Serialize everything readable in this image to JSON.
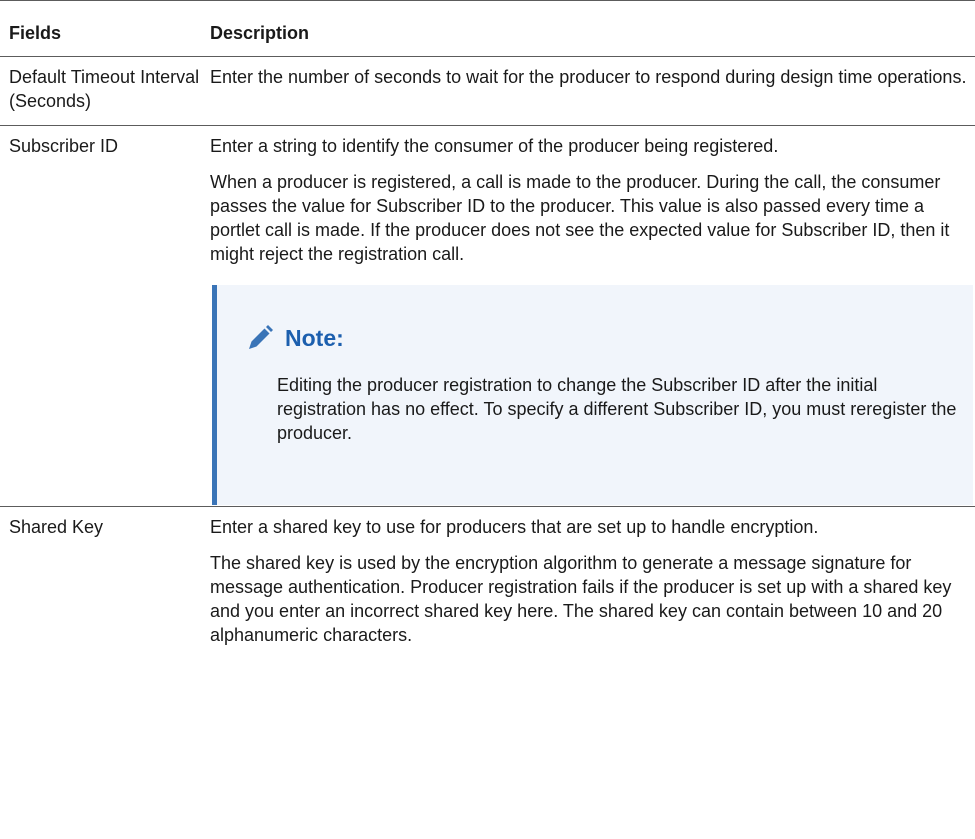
{
  "table": {
    "headers": [
      "Fields",
      "Description"
    ],
    "rows": [
      {
        "field": "Default Timeout Interval (Seconds)",
        "paragraphs": [
          "Enter the number of seconds to wait for the producer to respond during design time operations."
        ]
      },
      {
        "field": "Subscriber ID",
        "paragraphs": [
          "Enter a string to identify the consumer of the producer being registered.",
          "When a producer is registered, a call is made to the producer. During the call, the consumer passes the value for Subscriber ID to the producer. This value is also passed every time a portlet call is made. If the producer does not see the expected value for Subscriber ID, then it might reject the registration call."
        ],
        "note": {
          "icon": "pencil-icon",
          "title": "Note:",
          "text": "Editing the producer registration to change the Subscriber ID after the initial registration has no effect. To specify a different Subscriber ID, you must reregister the producer."
        }
      },
      {
        "field": "Shared Key",
        "paragraphs": [
          "Enter a shared key to use for producers that are set up to handle encryption.",
          "The shared key is used by the encryption algorithm to generate a message signature for message authentication. Producer registration fails if the producer is set up with a shared key and you enter an incorrect shared key here. The shared key can contain between 10 and 20 alphanumeric characters."
        ]
      }
    ]
  },
  "colors": {
    "note_accent": "#3a74b7",
    "note_title": "#1c5fae",
    "note_background": "#f1f5fb",
    "rule": "#5c5c5c"
  }
}
